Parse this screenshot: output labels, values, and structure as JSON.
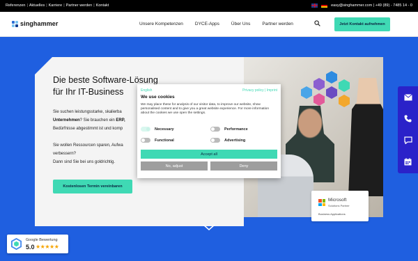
{
  "topbar": {
    "links": [
      "Referenzen",
      "Aktuelles",
      "Karriere",
      "Partner werden",
      "Kontakt"
    ],
    "separator": "|",
    "contact": "easy@singhammer.com | +49 (89) - 7485 14 - 0"
  },
  "header": {
    "logo_text": "singhammer",
    "nav": [
      "Unsere Kompetenzen",
      "DYCE-Apps",
      "Über Uns",
      "Partner werden"
    ],
    "cta_label": "Jetzt Kontakt aufnehmen"
  },
  "hero": {
    "title_line1": "Die beste Software-Lösung",
    "title_line2": "für Ihr IT-Business",
    "p1_a": "Sie suchen leistungsstarke, skalierba",
    "p1_b": "Unternehmen",
    "p1_c": "? Sie brauchen ein ",
    "p1_d": "ERP,",
    "p1_e": "Bedürfnisse abgestimmt ist und komp",
    "p2_a": "Sie wollen Ressourcen sparen, Aufwa",
    "p2_b": "verbessern?",
    "p2_c": "Dann sind Sie bei uns goldrichtig.",
    "button_label": "Kostenlosen Termin vereinbaren"
  },
  "badge": {
    "name": "Microsoft",
    "sub": "Solutions Partner",
    "area": "Business Applications"
  },
  "google": {
    "title": "Google Bewertung",
    "score": "5.0",
    "stars": "★★★★★",
    "rating": 5.0
  },
  "cookie": {
    "lang": "English",
    "policy": "Privacy policy | Imprint",
    "title": "We use cookies",
    "text": "We may place these for analysis of our visitor data, to improve our website, show personalised content and to give you a great website experience. For more information about the cookies we use open the settings.",
    "options": [
      {
        "label": "Necessary",
        "on": true
      },
      {
        "label": "Performance",
        "on": false
      },
      {
        "label": "Functional",
        "on": false
      },
      {
        "label": "Advertising",
        "on": false
      }
    ],
    "accept_label": "Accept all",
    "adjust_label": "No, adjust",
    "deny_label": "Deny"
  },
  "colors": {
    "accent": "#3fd9b4",
    "background": "#1f5fe0",
    "sidebar": "#2a22c9"
  },
  "sidebar_icons": [
    "mail-icon",
    "phone-icon",
    "chat-icon",
    "calendar-icon"
  ]
}
